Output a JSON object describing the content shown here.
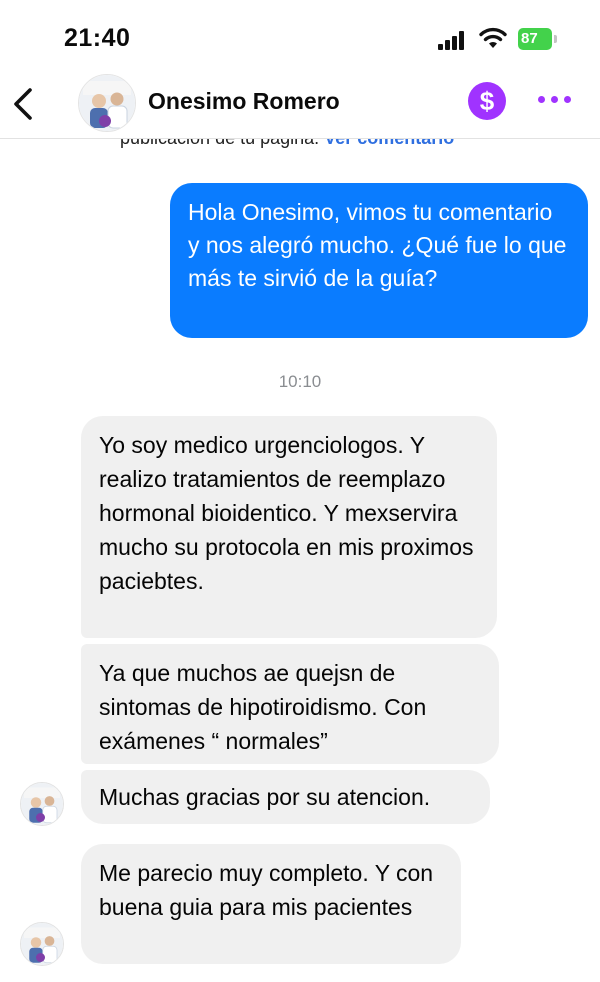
{
  "status_bar": {
    "time": "21:40",
    "battery": "87"
  },
  "header": {
    "contact_name": "Onesimo Romero",
    "icons": {
      "back": "chevron-left-icon",
      "payment": "dollar-icon",
      "more": "more-dots-icon"
    }
  },
  "context": {
    "text": "publicacion de tu pagina.",
    "link": "Ver comentario"
  },
  "messages": {
    "outgoing_1": "Hola Onesimo, vimos tu comentario y nos alegró mucho. ¿Qué fue lo que más te sirvió de la guía?",
    "timestamp": "10:10",
    "incoming_1": "Yo soy medico urgenciologos.  Y realizo tratamientos de reemplazo hormonal bioidentico.  Y mexservira mucho su protocola en mis proximos paciebtes.",
    "incoming_2": "Ya que muchos ae quejsn de sintomas de hipotiroidismo. Con exámenes “ normales”",
    "incoming_3": "Muchas gracias por su atencion.",
    "incoming_4": "Me parecio muy completo.  Y con buena guia para mis pacientes"
  },
  "colors": {
    "outgoing_bubble": "#0a7cff",
    "incoming_bubble": "#f0f0f0",
    "accent": "#a033ff",
    "battery": "#43d24b"
  }
}
